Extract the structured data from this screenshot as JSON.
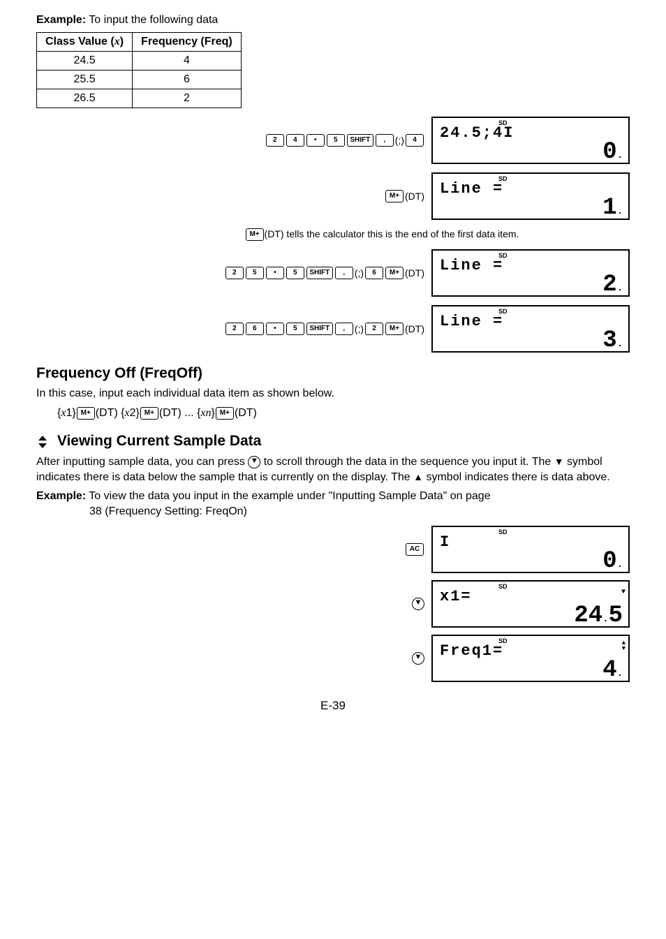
{
  "example_label": "Example:",
  "example_text": " To input the following data",
  "table": {
    "headers": [
      "Class Value (x)",
      "Frequency (Freq)"
    ],
    "rows": [
      [
        "24.5",
        "4"
      ],
      [
        "25.5",
        "6"
      ],
      [
        "26.5",
        "2"
      ]
    ]
  },
  "keys": {
    "k2": "2",
    "k4": "4",
    "k5": "5",
    "k6": "6",
    "dot": "•",
    "shift": "SHIFT",
    "comma": ",",
    "mplus": "M+",
    "ac": "AC"
  },
  "paren_semi": "(;)",
  "paren_dt": "(DT)",
  "displays": {
    "d1": {
      "line1": "24.5;4I",
      "line2": "0."
    },
    "d2": {
      "line1": "Line =",
      "line2": "1."
    },
    "d3": {
      "line1": "Line =",
      "line2": "2."
    },
    "d4": {
      "line1": "Line =",
      "line2": "3."
    }
  },
  "dt_note": "(DT) tells the calculator this is the end of the first data item.",
  "freqoff": {
    "title": "Frequency Off (FreqOff)",
    "body": "In this case, input each individual data item as shown below.",
    "seq_parts": {
      "x1": "{x1}",
      "x2": "{x2}",
      "dots": " ... ",
      "xn": "{xn}"
    }
  },
  "viewing": {
    "title": " Viewing Current Sample Data",
    "p1a": "After inputting sample data, you can press ",
    "p1b": " to scroll through the data in the sequence you input it. The ",
    "p1c": " symbol indicates there is data below the sample that is currently on the display. The ",
    "p1d": " symbol indicates there is data above.",
    "ex_label": "Example:",
    "ex_body1": " To view the data you input in the example under \"Inputting Sample Data\" on page",
    "ex_body2": "38 (Frequency Setting: FreqOn)"
  },
  "view_displays": {
    "v1": {
      "line1": "I",
      "line2": "0."
    },
    "v2": {
      "line1": "x1=",
      "line2": "24.5"
    },
    "v3": {
      "line1": "Freq1=",
      "line2": "4."
    }
  },
  "sd_label": "SD",
  "page_num": "E-39"
}
